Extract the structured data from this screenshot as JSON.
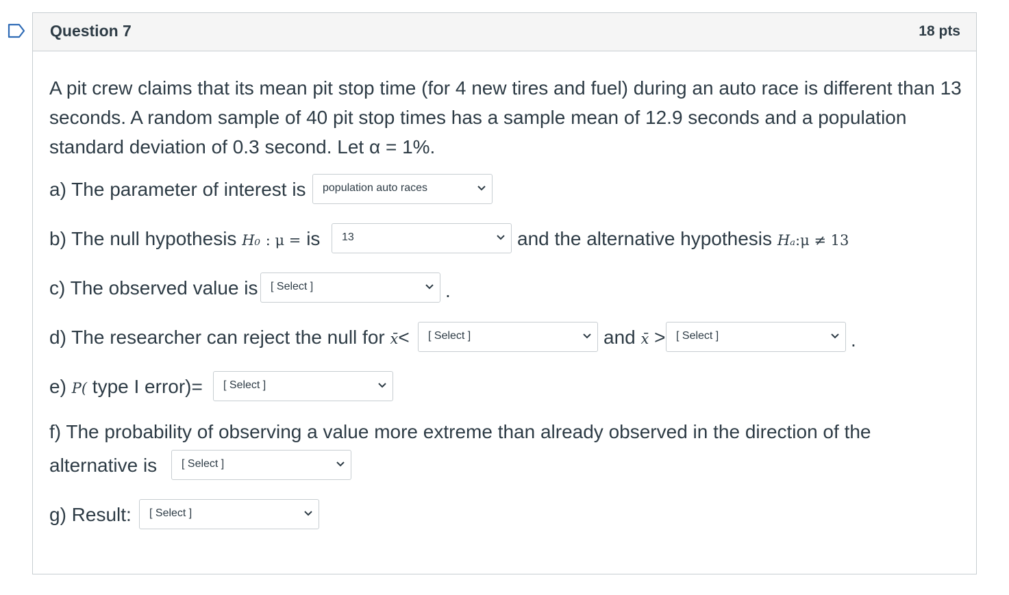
{
  "question": {
    "title": "Question 7",
    "points": "18 pts",
    "prompt": "A pit crew claims that its mean pit stop time (for 4 new tires and fuel) during an auto race is different than 13 seconds. A random sample of 40 pit stop times has a sample mean of 12.9 seconds and a population standard deviation of 0.3 second. Let α = 1%."
  },
  "parts": {
    "a": {
      "label": "a) The parameter of interest is",
      "selected": "population auto races"
    },
    "b": {
      "label": "b) The null hypothesis",
      "h0": "H₀",
      "colon_mu": ": μ =",
      "is": "is",
      "selected": "13",
      "alt_label": "and the alternative hypothesis",
      "ha": "Hₐ",
      "alt_expr": ":μ ≠ 13"
    },
    "c": {
      "label": "c) The observed value is",
      "selected": "[ Select ]",
      "end": "."
    },
    "d": {
      "label": "d) The researcher can reject the null for",
      "xbar": "x̄",
      "lt": "<",
      "selected1": "[ Select ]",
      "and": "and",
      "gt": ">",
      "selected2": "[ Select ]",
      "end": "."
    },
    "e": {
      "label_pre": "e)",
      "p": "P(",
      "label_post": "type I error)=",
      "selected": "[ Select ]"
    },
    "f": {
      "line1": "f) The probability of observing a value more extreme than already observed in the direction of the",
      "line2": "alternative is",
      "selected": "[ Select ]"
    },
    "g": {
      "label": "g) Result:",
      "selected": "[ Select ]"
    }
  },
  "icons": {
    "flag": "bookmark-flag-icon",
    "chevron": "chevron-down-icon"
  },
  "colors": {
    "text": "#2d3b45",
    "border": "#c7cdd1",
    "flag": "#2d6ab5"
  }
}
